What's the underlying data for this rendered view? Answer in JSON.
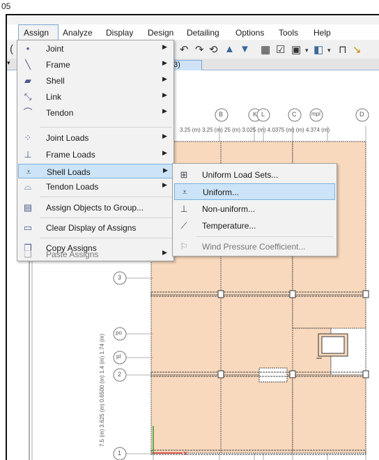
{
  "window": {
    "corner_text": "05"
  },
  "menubar": {
    "items": [
      "Assign",
      "Analyze",
      "Display",
      "Design",
      "Detailing",
      "Options",
      "Tools",
      "Help"
    ]
  },
  "doc_tab": {
    "label": "3)"
  },
  "assign_menu": {
    "items": [
      {
        "label": "Joint",
        "icon": "joint-icon",
        "submenu": true
      },
      {
        "label": "Frame",
        "icon": "frame-icon",
        "submenu": true
      },
      {
        "label": "Shell",
        "icon": "shell-icon",
        "submenu": true
      },
      {
        "label": "Link",
        "icon": "link-icon",
        "submenu": true
      },
      {
        "label": "Tendon",
        "icon": "tendon-icon",
        "submenu": true
      },
      {
        "label": "Joint Loads",
        "icon": "joint-loads-icon",
        "submenu": true
      },
      {
        "label": "Frame Loads",
        "icon": "frame-loads-icon",
        "submenu": true
      },
      {
        "label": "Shell Loads",
        "icon": "shell-loads-icon",
        "submenu": true,
        "highlighted": true
      },
      {
        "label": "Tendon Loads",
        "icon": "tendon-loads-icon",
        "submenu": true
      },
      {
        "label": "Assign Objects to Group...",
        "icon": "group-icon",
        "submenu": false
      },
      {
        "label": "Clear Display of Assigns",
        "icon": "clear-display-icon",
        "submenu": false
      },
      {
        "label": "Copy Assigns",
        "icon": "copy-icon",
        "submenu": false
      },
      {
        "label": "Paste Assigns",
        "icon": "paste-icon",
        "submenu": true,
        "disabled": true
      }
    ]
  },
  "shell_loads_submenu": {
    "items": [
      {
        "label": "Uniform Load Sets...",
        "icon": "uniform-load-sets-icon"
      },
      {
        "label": "Uniform...",
        "icon": "uniform-icon",
        "highlighted": true
      },
      {
        "label": "Non-uniform...",
        "icon": "non-uniform-icon"
      },
      {
        "label": "Temperature...",
        "icon": "temperature-icon"
      },
      {
        "label": "Wind Pressure Coefficient...",
        "icon": "wind-pressure-icon",
        "disabled": true
      }
    ]
  },
  "grid": {
    "column_bubbles": [
      "B",
      "K",
      "L",
      "C",
      "mpl",
      "D"
    ],
    "row_bubbles": [
      "3",
      "po",
      "pl",
      "2",
      "1"
    ],
    "top_dims": "3.25 (m) 3.25 (m) 25 (m) 3.025 (m) 4.0375 (m) (m) 4.374 (m)",
    "left_dims": "7.5 (m) 3.625 (m) 0.6500 (m) 1.4 (m) 1.74 (m)"
  },
  "colors": {
    "slab_fill": "#f9d9bd",
    "highlight": "#cce4f7",
    "highlight_border": "#7ab0e0",
    "menu_bg": "#f2f2f2"
  }
}
